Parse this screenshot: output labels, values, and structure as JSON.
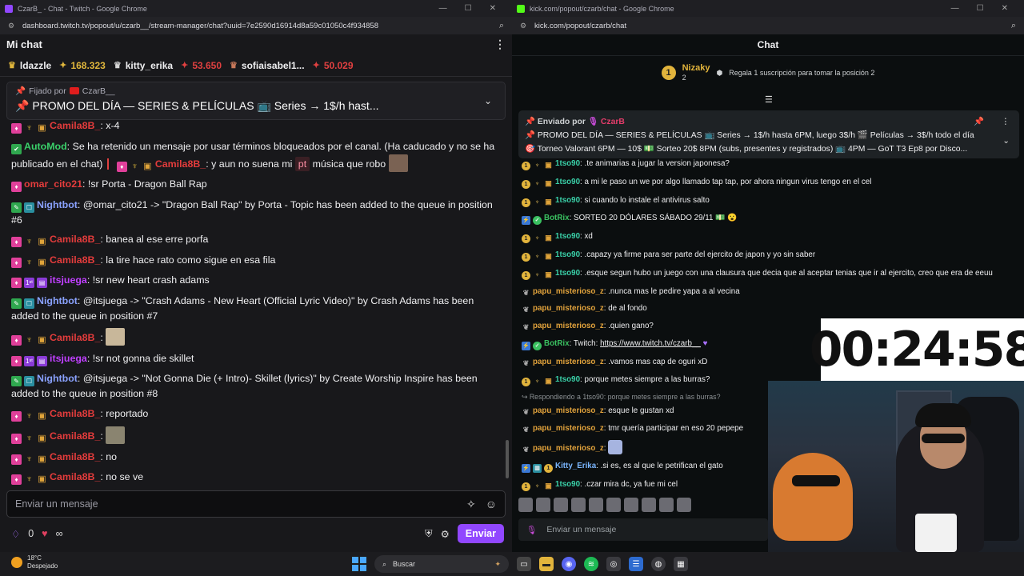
{
  "left_window": {
    "tab_title": "CzarB_ - Chat - Twitch - Google Chrome",
    "url": "dashboard.twitch.tv/popout/u/czarb__/stream-manager/chat?uuid=7e2590d16914d8a59c01050c4f934858",
    "header_title": "Mi chat",
    "leaderboard": [
      {
        "name": "ldazzle",
        "icon": "crown-icon"
      },
      {
        "value": "168.323",
        "icon": "gem-icon"
      },
      {
        "name": "kitty_erika",
        "icon": "crown-icon"
      },
      {
        "value": "53.650",
        "icon": "gem-icon"
      },
      {
        "name": "sofiaisabel1...",
        "icon": "crown-icon"
      },
      {
        "value": "50.029",
        "icon": "gem-icon"
      }
    ],
    "pinned": {
      "label": "Fijado por",
      "by": "CzarB__",
      "text": "📌 PROMO DEL DÍA — SERIES & PELÍCULAS 📺 Series → 1$/h hast..."
    },
    "messages": [
      {
        "user": "Camila8B_",
        "text": "x-4"
      },
      {
        "user": "AutoMod",
        "text": "Se ha retenido un mensaje por usar términos bloqueados por el canal. (Ha caducado y no se ha publicado en el chat)",
        "held_user": "Camila8B_",
        "held_text_1": "y aun no suena mi",
        "held_tag": "pt",
        "held_text_2": "música que robo"
      },
      {
        "user": "omar_cito21",
        "text": "!sr Porta - Dragon Ball Rap"
      },
      {
        "user": "Nightbot",
        "text": "@omar_cito21 -> \"Dragon Ball Rap\" by Porta - Topic has been added to the queue in position #6"
      },
      {
        "user": "Camila8B_",
        "text": "banea al ese erre porfa"
      },
      {
        "user": "Camila8B_",
        "text": "la tire hace rato como sigue en esa fila"
      },
      {
        "user": "itsjuega",
        "text": "!sr new heart crash adams"
      },
      {
        "user": "Nightbot",
        "text": "@itsjuega -> \"Crash Adams - New Heart (Official Lyric Video)\" by Crash Adams has been added to the queue in position #7"
      },
      {
        "user": "Camila8B_",
        "text": ""
      },
      {
        "user": "itsjuega",
        "text": "!sr not gonna die skillet"
      },
      {
        "user": "Nightbot",
        "text": "@itsjuega -> \"Not Gonna Die (+ Intro)- Skillet (lyrics)\" by Create Worship Inspire has been added to the queue in position #8"
      },
      {
        "user": "Camila8B_",
        "text": "reportado"
      },
      {
        "user": "Camila8B_",
        "text": ""
      },
      {
        "user": "Camila8B_",
        "text": "no"
      },
      {
        "user": "Camila8B_",
        "text": "no se ve"
      }
    ],
    "input_placeholder": "Enviar un mensaje",
    "points": "0",
    "infinity": "∞",
    "send_label": "Enviar"
  },
  "right_window": {
    "tab_title": "kick.com/popout/czarb/chat - Google Chrome",
    "url": "kick.com/popout/czarb/chat",
    "header_title": "Chat",
    "top_gifter": {
      "rank": "1",
      "name": "Nizaky",
      "count": "2",
      "hint": "Regala 1 suscripción para tomar la posición 2"
    },
    "pinned": {
      "label": "Enviado por",
      "by": "CzarB",
      "line1": "📌 PROMO DEL DÍA — SERIES & PELÍCULAS 📺 Series → 1$/h hasta 6PM, luego 3$/h 🎬 Películas → 3$/h todo el día",
      "line2": "🎯 Torneo Valorant 6PM — 10$ 💵 Sorteo 20$ 8PM (subs, presentes y registrados) 📺 4PM — GoT T3 Ep8 por Disco..."
    },
    "messages": [
      {
        "user": "1tso90",
        "text": ".te animarias a jugar la version japonesa?",
        "style": "teal"
      },
      {
        "user": "1tso90",
        "text": "a mi le paso un we por algo llamado tap tap, por ahora ningun virus tengo en el cel",
        "style": "teal"
      },
      {
        "user": "1tso90",
        "text": "si cuando lo instale el antivirus salto",
        "style": "teal"
      },
      {
        "user": "BotRix",
        "text": "SORTEO 20 DÓLARES SÁBADO 29/11 💵 😮",
        "style": "green"
      },
      {
        "user": "1tso90",
        "text": "xd",
        "style": "teal"
      },
      {
        "user": "1tso90",
        "text": ".capazy ya firme para ser parte del ejercito de japon y yo sin saber",
        "style": "teal"
      },
      {
        "user": "1tso90",
        "text": ".esque segun hubo un juego con una clausura que decia que al aceptar tenias que ir al ejercito, creo que era de eeuu",
        "style": "teal"
      },
      {
        "user": "papu_misterioso_z",
        "text": ".nunca mas le pedire yapa a al vecina",
        "style": "gold"
      },
      {
        "user": "papu_misterioso_z",
        "text": "de al fondo",
        "style": "gold"
      },
      {
        "user": "papu_misterioso_z",
        "text": ".quien gano?",
        "style": "gold"
      },
      {
        "user": "BotRix",
        "text": "Twitch: ",
        "link": "https://www.twitch.tv/czarb__",
        "style": "green"
      },
      {
        "user": "papu_misterioso_z",
        "text": ".vamos mas cap de oguri xD",
        "style": "gold"
      },
      {
        "user": "1tso90",
        "text": "porque metes siempre a las burras?",
        "style": "teal"
      },
      {
        "user": "papu_misterioso_z",
        "text": "esque le gustan xd",
        "style": "gold",
        "reply": "Respondiendo a 1tso90: porque metes siempre a las burras?"
      },
      {
        "user": "papu_misterioso_z",
        "text": "tmr quería participar en eso 20 pepepe",
        "style": "gold"
      },
      {
        "user": "papu_misterioso_z",
        "text": "",
        "style": "gold"
      },
      {
        "user": "Kitty_Erika",
        "text": ".si es, es al que le petrifican el gato",
        "style": "blue"
      },
      {
        "user": "1tso90",
        "text": ".czar mira dc, ya fue mi cel",
        "style": "teal"
      }
    ],
    "input_placeholder": "Enviar un mensaje",
    "timer": "00:24:58"
  },
  "taskbar": {
    "temperature": "18°C",
    "condition": "Despejado",
    "search_label": "Buscar"
  },
  "colors": {
    "twitch_purple": "#9147ff",
    "kick_green": "#53fc18"
  }
}
